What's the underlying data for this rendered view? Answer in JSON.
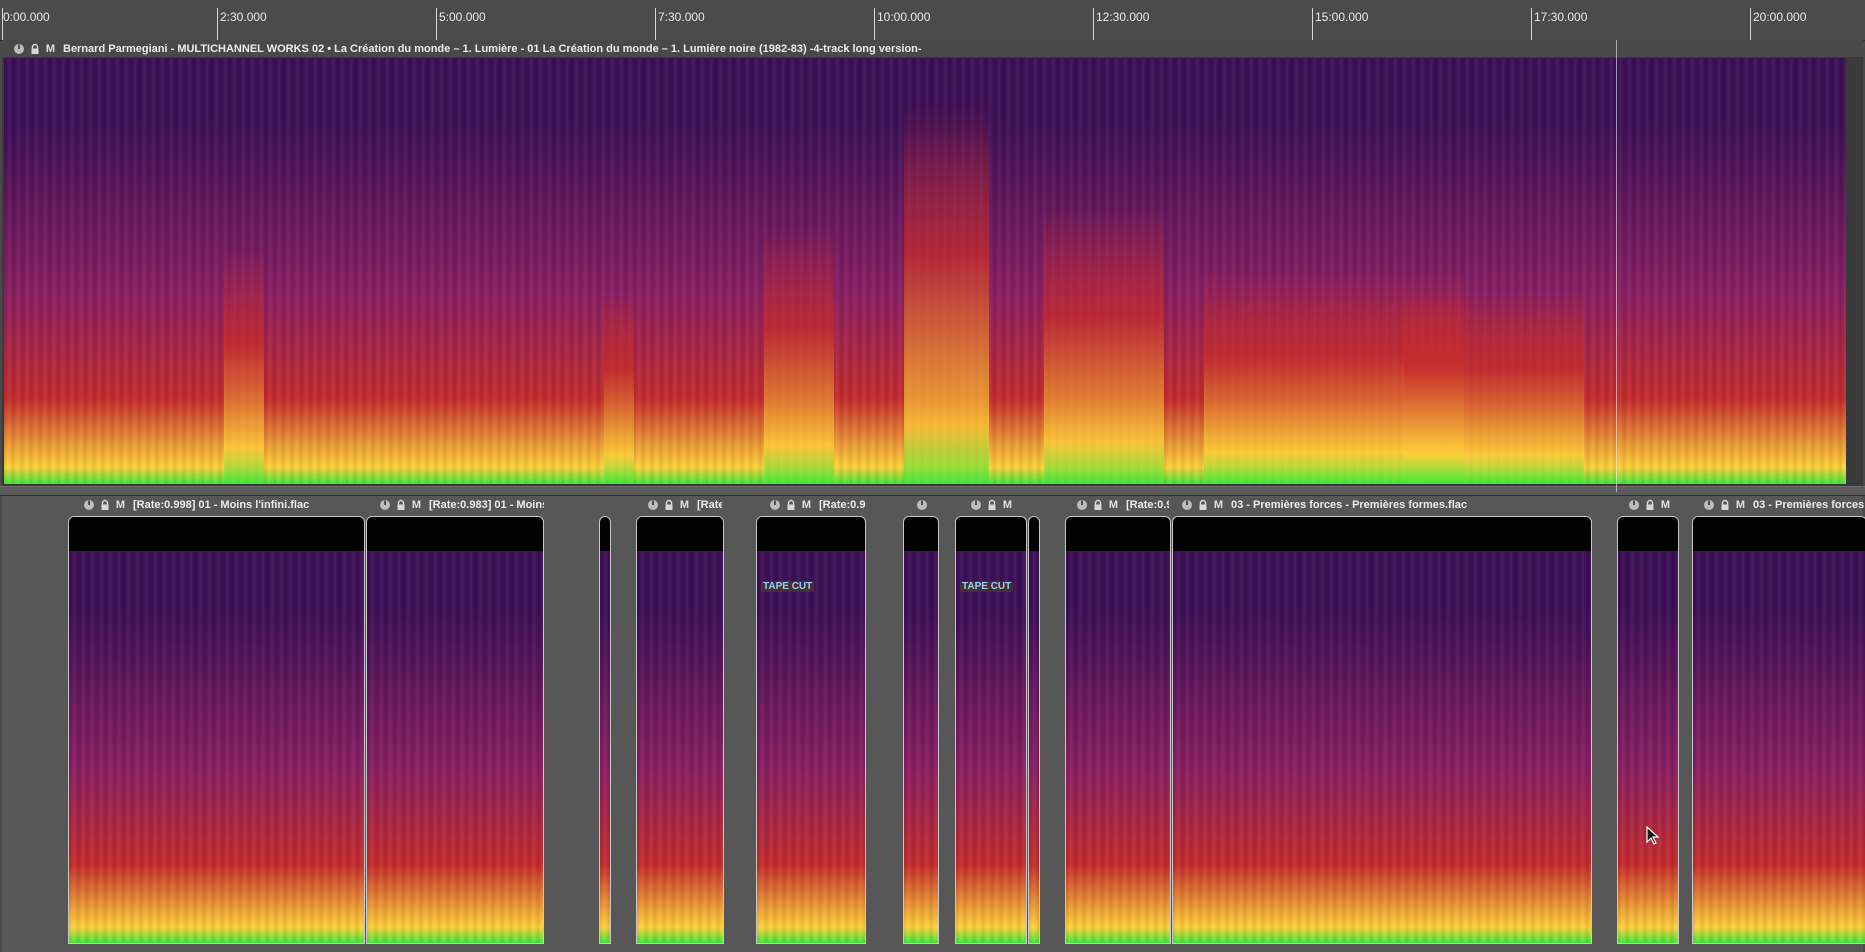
{
  "ruler": {
    "ticks": [
      {
        "label": "0:00.000"
      },
      {
        "label": "2:30.000"
      },
      {
        "label": "5:00.000"
      },
      {
        "label": "7:30.000"
      },
      {
        "label": "10:00.000"
      },
      {
        "label": "12:30.000"
      },
      {
        "label": "15:00.000"
      },
      {
        "label": "17:30.000"
      },
      {
        "label": "20:00.000"
      }
    ]
  },
  "track1": {
    "title": "Bernard Parmegiani - MULTICHANNEL WORKS 02 • La Création du monde – 1. Lumière - 01 La Création du monde – 1. Lumière noire (1982-83) -4-track long version-",
    "mute_label": "M"
  },
  "track2": {
    "clips": [
      {
        "title": "[Rate:0.998] 01 - Moins l'infini.flac",
        "mute_label": "M"
      },
      {
        "title": "[Rate:0.983] 01 - Moins",
        "mute_label": "M"
      },
      {
        "title": "[Rate",
        "mute_label": "M"
      },
      {
        "title": "[Rate:0.9",
        "mute_label": "M"
      },
      {
        "title": "",
        "mute_label": "M"
      },
      {
        "title": "[Rate:0.9",
        "mute_label": "M"
      },
      {
        "title": "03 - Premières forces - Premières formes.flac",
        "mute_label": "M"
      },
      {
        "title": "",
        "mute_label": "M"
      },
      {
        "title": "03 - Premières forces",
        "mute_label": "M"
      }
    ],
    "tape_cut_label": "TAPE CUT"
  },
  "colors": {
    "spectrogram_low": "#3d0f57",
    "spectrogram_mid": "#c62c2c",
    "spectrogram_high": "#ffd23a",
    "spectrogram_peak": "#3fe83a"
  }
}
